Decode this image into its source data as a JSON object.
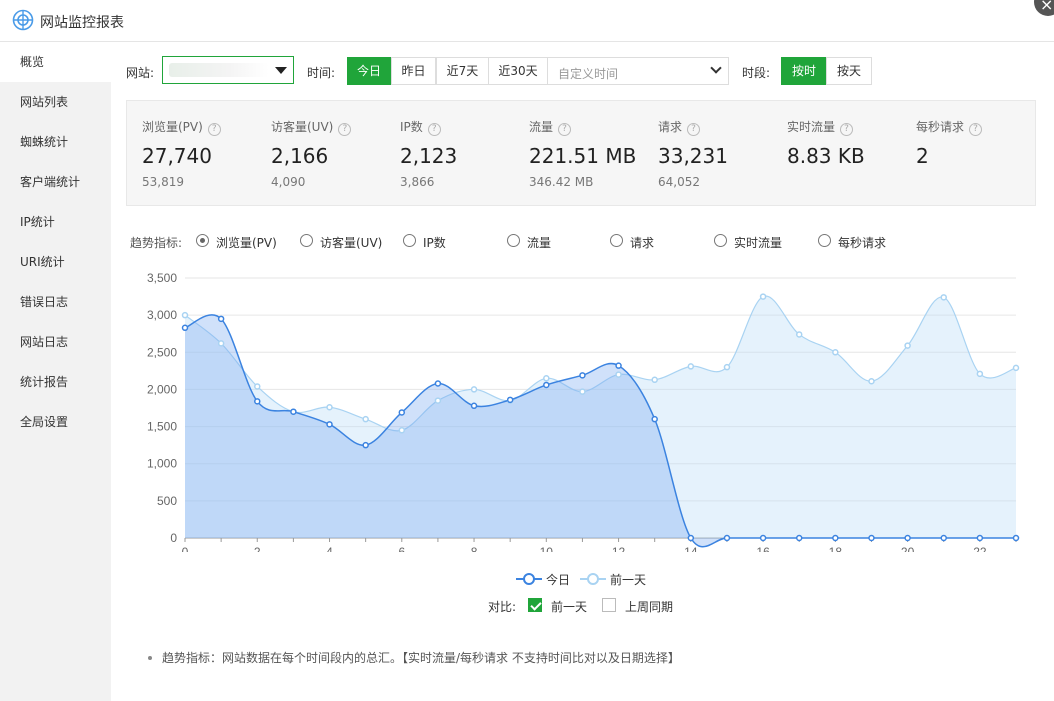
{
  "window": {
    "title": "网站监控报表",
    "close_glyph": "×"
  },
  "sidebar": {
    "items": [
      {
        "label": "概览",
        "active": true
      },
      {
        "label": "网站列表"
      },
      {
        "label": "蜘蛛统计"
      },
      {
        "label": "客户端统计"
      },
      {
        "label": "IP统计"
      },
      {
        "label": "URI统计"
      },
      {
        "label": "错误日志"
      },
      {
        "label": "网站日志"
      },
      {
        "label": "统计报告"
      },
      {
        "label": "全局设置"
      }
    ]
  },
  "filters": {
    "site_label": "网站:",
    "time_label": "时间:",
    "time_options": [
      "今日",
      "昨日",
      "近7天",
      "近30天"
    ],
    "time_selected": "今日",
    "custom_time_placeholder": "自定义时间",
    "period_label": "时段:",
    "period_options": [
      "按时",
      "按天"
    ],
    "period_selected": "按时"
  },
  "stats": [
    {
      "name": "浏览量(PV)",
      "value": "27,740",
      "prev": "53,819"
    },
    {
      "name": "访客量(UV)",
      "value": "2,166",
      "prev": "4,090"
    },
    {
      "name": "IP数",
      "value": "2,123",
      "prev": "3,866"
    },
    {
      "name": "流量",
      "value": "221.51 MB",
      "prev": "346.42 MB"
    },
    {
      "name": "请求",
      "value": "33,231",
      "prev": "64,052"
    },
    {
      "name": "实时流量",
      "value": "8.83 KB",
      "prev": ""
    },
    {
      "name": "每秒请求",
      "value": "2",
      "prev": ""
    }
  ],
  "help_glyph": "?",
  "trend": {
    "label": "趋势指标:",
    "options": [
      "浏览量(PV)",
      "访客量(UV)",
      "IP数",
      "流量",
      "请求",
      "实时流量",
      "每秒请求"
    ],
    "selected": "浏览量(PV)"
  },
  "colors": {
    "accent": "#20a53a",
    "today_line": "#3b83e0",
    "prev_line": "#a9d3f2"
  },
  "chart_data": {
    "type": "area",
    "x": [
      0,
      1,
      2,
      3,
      4,
      5,
      6,
      7,
      8,
      9,
      10,
      11,
      12,
      13,
      14,
      15,
      16,
      17,
      18,
      19,
      20,
      21,
      22,
      23
    ],
    "x_ticks": [
      0,
      2,
      4,
      6,
      8,
      10,
      12,
      14,
      16,
      18,
      20,
      22
    ],
    "y_ticks": [
      "0",
      "500",
      "1,000",
      "1,500",
      "2,000",
      "2,500",
      "3,000",
      "3,500"
    ],
    "ylim": [
      0,
      3500
    ],
    "grid": true,
    "legend_position": "bottom-center",
    "series": [
      {
        "name": "今日",
        "values": [
          2830,
          2950,
          1840,
          1700,
          1530,
          1250,
          1690,
          2080,
          1780,
          1860,
          2060,
          2190,
          2320,
          1600,
          0,
          0,
          0,
          0,
          0,
          0,
          0,
          0,
          0,
          0
        ]
      },
      {
        "name": "前一天",
        "values": [
          3000,
          2620,
          2040,
          1700,
          1760,
          1600,
          1450,
          1850,
          2000,
          1850,
          2150,
          1970,
          2200,
          2130,
          2310,
          2300,
          3250,
          2740,
          2500,
          2110,
          2590,
          3240,
          2210,
          2290
        ]
      }
    ]
  },
  "compare": {
    "label": "对比:",
    "options": [
      {
        "label": "前一天",
        "checked": true
      },
      {
        "label": "上周同期",
        "checked": false
      }
    ]
  },
  "note": "趋势指标：网站数据在每个时间段内的总汇。【实时流量/每秒请求 不支持时间比对以及日期选择】"
}
